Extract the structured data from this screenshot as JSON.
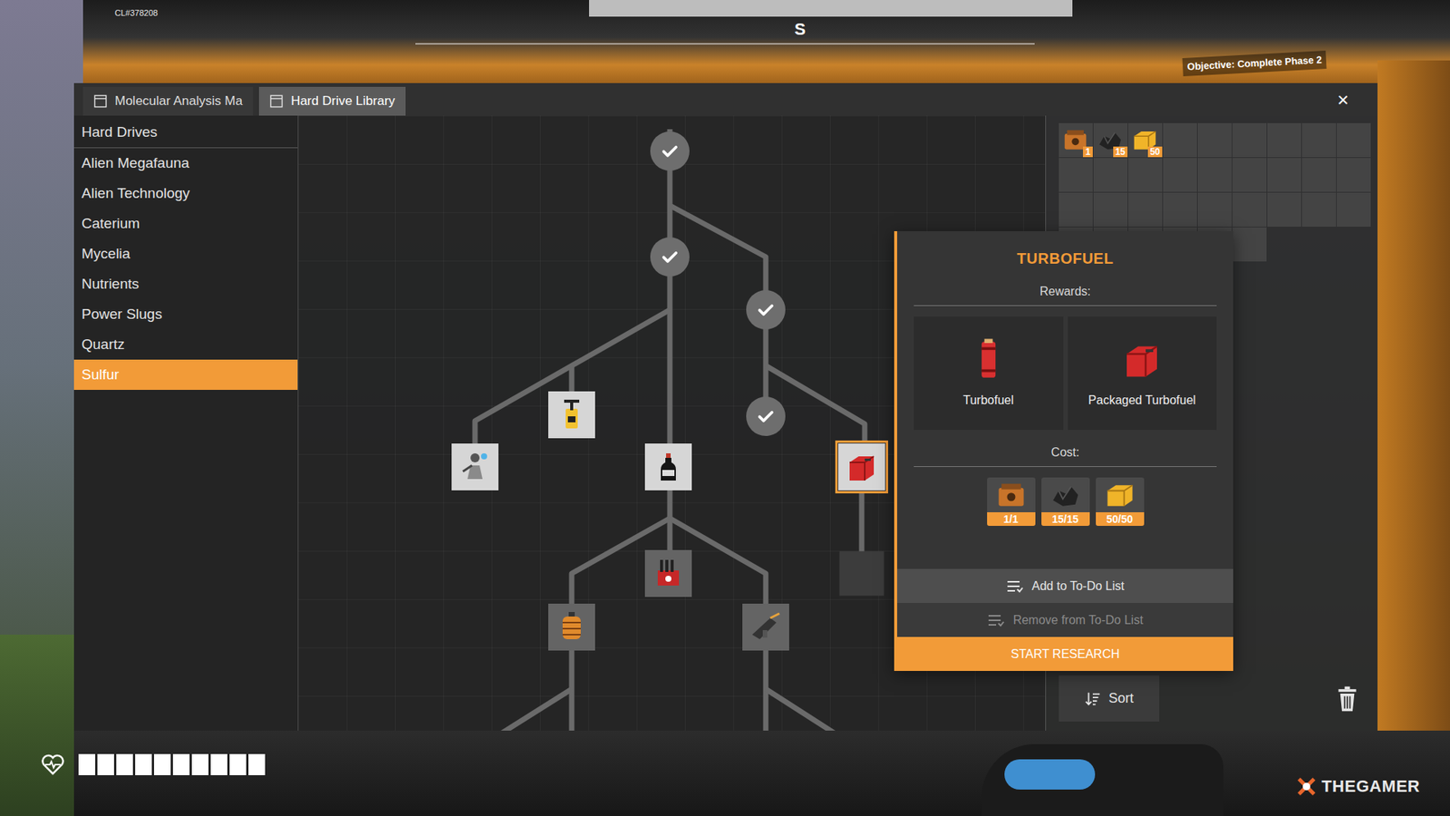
{
  "hud": {
    "build": "CL#378208",
    "compass": "S",
    "objective": "Objective: Complete Phase 2",
    "health": {
      "level": 1
    }
  },
  "window": {
    "tabs": [
      {
        "label": "Molecular Analysis Ma",
        "selected": false
      },
      {
        "label": "Hard Drive Library",
        "selected": true
      }
    ],
    "close": "×"
  },
  "sidebar": {
    "items": [
      {
        "label": "Hard Drives",
        "selected": false
      },
      {
        "label": "Alien Megafauna",
        "selected": false
      },
      {
        "label": "Alien Technology",
        "selected": false
      },
      {
        "label": "Caterium",
        "selected": false
      },
      {
        "label": "Mycelia",
        "selected": false
      },
      {
        "label": "Nutrients",
        "selected": false
      },
      {
        "label": "Power Slugs",
        "selected": false
      },
      {
        "label": "Quartz",
        "selected": false
      },
      {
        "label": "Sulfur",
        "selected": true
      }
    ]
  },
  "tree": {
    "nodes": [
      {
        "kind": "check",
        "selected": false
      },
      {
        "kind": "check",
        "selected": false
      },
      {
        "kind": "check",
        "selected": false
      },
      {
        "kind": "check",
        "selected": false
      },
      {
        "kind": "item",
        "locked": false,
        "selected": false
      },
      {
        "kind": "item",
        "locked": false,
        "selected": false
      },
      {
        "kind": "item",
        "locked": false,
        "selected": false
      },
      {
        "kind": "item",
        "locked": false,
        "selected": true
      },
      {
        "kind": "item",
        "locked": true,
        "selected": false
      },
      {
        "kind": "item",
        "locked": true,
        "selected": false
      },
      {
        "kind": "item",
        "locked": true,
        "selected": false
      },
      {
        "kind": "empty",
        "selected": false
      }
    ]
  },
  "inventory": {
    "slots": [
      {
        "count": "1"
      },
      {
        "count": "15"
      },
      {
        "count": "50"
      }
    ],
    "sort_button": "Sort"
  },
  "popup": {
    "title": "TURBOFUEL",
    "rewards_label": "Rewards:",
    "rewards": [
      {
        "label": "Turbofuel"
      },
      {
        "label": "Packaged Turbofuel"
      }
    ],
    "cost_label": "Cost:",
    "cost": [
      {
        "count": "1/1"
      },
      {
        "count": "15/15"
      },
      {
        "count": "50/50"
      }
    ],
    "buttons": [
      {
        "label": "Add to To-Do List",
        "kind": "secondary",
        "disabled": false
      },
      {
        "label": "Remove from To-Do List",
        "kind": "secondary",
        "disabled": true
      },
      {
        "label": "START RESEARCH",
        "kind": "primary",
        "disabled": false
      }
    ]
  },
  "watermark": "THEGAMER"
}
